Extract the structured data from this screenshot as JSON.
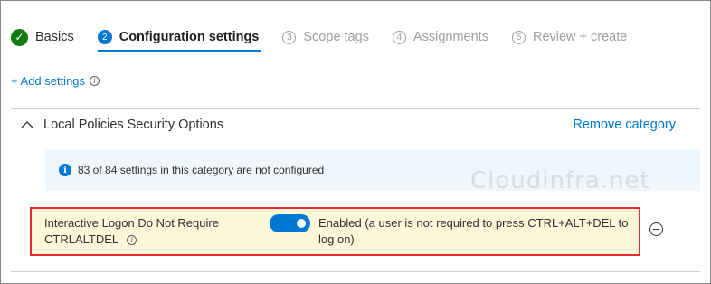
{
  "wizard": {
    "steps": [
      {
        "num": "✓",
        "label": "Basics",
        "state": "done"
      },
      {
        "num": "2",
        "label": "Configuration settings",
        "state": "current"
      },
      {
        "num": "3",
        "label": "Scope tags",
        "state": "pending"
      },
      {
        "num": "4",
        "label": "Assignments",
        "state": "pending"
      },
      {
        "num": "5",
        "label": "Review + create",
        "state": "pending"
      }
    ]
  },
  "add_settings_label": "+ Add settings",
  "category": {
    "title": "Local Policies Security Options",
    "remove_label": "Remove category",
    "notice": "83 of 84 settings in this category are not configured",
    "notice_icon": "i",
    "watermark": "Cloudinfra.net"
  },
  "setting": {
    "name": "Interactive Logon Do Not Require CTRLALTDEL",
    "value": "Enabled (a user is not required to press CTRL+ALT+DEL to log on)",
    "enabled": true
  },
  "colors": {
    "accent": "#0078d4",
    "success": "#107c10",
    "highlight_border": "#e8262d",
    "highlight_bg": "#fbf7d8"
  }
}
